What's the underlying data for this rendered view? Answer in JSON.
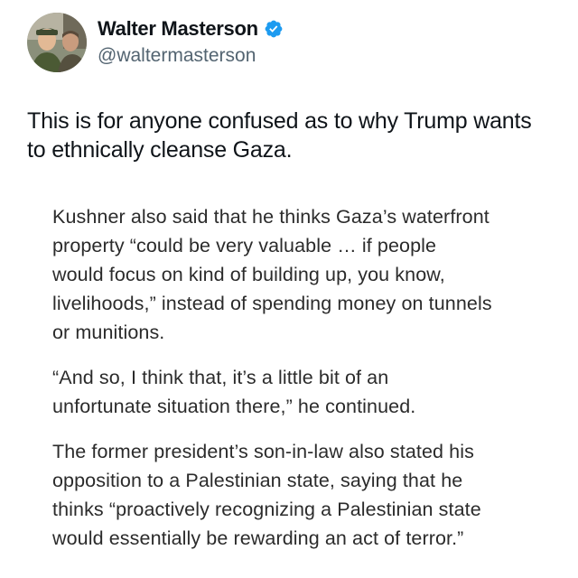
{
  "author": {
    "display_name": "Walter Masterson",
    "handle": "@waltermasterson",
    "verified": true,
    "verified_color": "#1d9bf0",
    "avatar_icon": "profile-photo"
  },
  "tweet": {
    "text": "This is for anyone confused as to why Trump wants\nto ethnically cleanse Gaza."
  },
  "quoted_article": {
    "paragraphs": [
      "Kushner also said that he thinks Gaza’s waterfront\nproperty “could be very valuable … if people\nwould focus on kind of building up, you know,\nlivelihoods,” instead of spending money on tunnels\nor munitions.",
      "“And so, I think that, it’s a little bit of an\nunfortunate situation there,” he continued.",
      "The former president’s son-in-law also stated his\nopposition to a Palestinian state, saying that he\nthinks “proactively recognizing a Palestinian state\nwould essentially be rewarding an act of terror.”"
    ]
  }
}
